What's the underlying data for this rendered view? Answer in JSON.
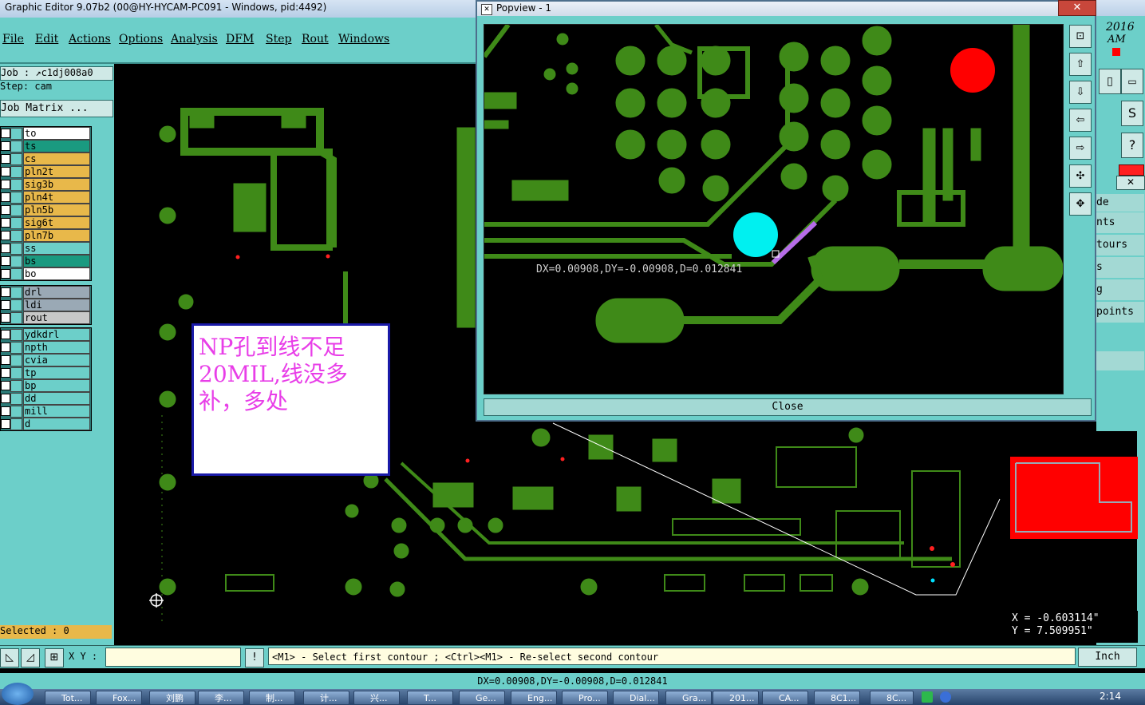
{
  "window": {
    "title": "Graphic Editor 9.07b2 (00@HY-HYCAM-PC091 - Windows, pid:4492)"
  },
  "menu": [
    "File",
    "Edit",
    "Actions",
    "Options",
    "Analysis",
    "DFM",
    "Step",
    "Rout",
    "Windows"
  ],
  "job": {
    "job_label": "Job : ↗c1dj008a0",
    "step_label": "Step: cam",
    "matrix_button": "Job Matrix ..."
  },
  "layers_group1": [
    {
      "name": "to",
      "color": "#ffffff"
    },
    {
      "name": "ts",
      "color": "#1a9a80"
    },
    {
      "name": "cs",
      "color": "#e8b84a"
    },
    {
      "name": "pln2t",
      "color": "#e8b84a"
    },
    {
      "name": "sig3b",
      "color": "#e8b84a"
    },
    {
      "name": "pln4t",
      "color": "#e8b84a"
    },
    {
      "name": "pln5b",
      "color": "#e8b84a"
    },
    {
      "name": "sig6t",
      "color": "#e8b84a"
    },
    {
      "name": "pln7b",
      "color": "#e8b84a"
    },
    {
      "name": "ss",
      "color": "#6ccfc9"
    },
    {
      "name": "bs",
      "color": "#1a9a80"
    },
    {
      "name": "bo",
      "color": "#ffffff"
    }
  ],
  "layers_group2": [
    {
      "name": "drl",
      "color": "#9aa9b5"
    },
    {
      "name": "ldi",
      "color": "#9aa9b5"
    },
    {
      "name": "rout",
      "color": "#c8c8c8"
    }
  ],
  "layers_group3": [
    {
      "name": "ydkdrl",
      "color": "#6ccfc9"
    },
    {
      "name": "npth",
      "color": "#6ccfc9"
    },
    {
      "name": "cvia",
      "color": "#6ccfc9"
    },
    {
      "name": "tp",
      "color": "#6ccfc9"
    },
    {
      "name": "bp",
      "color": "#6ccfc9"
    },
    {
      "name": "dd",
      "color": "#6ccfc9"
    },
    {
      "name": "mill",
      "color": "#6ccfc9"
    },
    {
      "name": "d",
      "color": "#6ccfc9"
    }
  ],
  "selected_label": "Selected : 0",
  "note": {
    "text": "NP孔到线不足20MIL,线没多补，多处"
  },
  "popview": {
    "title": "Popview - 1",
    "measure_text": "DX=0.00908,DY=-0.00908,D=0.012841",
    "close_label": "Close"
  },
  "right_panel": {
    "date": "2016",
    "ampm": "AM",
    "items": [
      "de",
      "nts",
      "tours",
      "s",
      "g",
      "points"
    ]
  },
  "coords": {
    "x": "X = -0.603114\"",
    "y": "Y = 7.509951\""
  },
  "bottom": {
    "xy_label": "X Y :",
    "prompt": "<M1> - Select first contour ; <Ctrl><M1> - Re-select second contour",
    "units": "Inch"
  },
  "status": "DX=0.00908,DY=-0.00908,D=0.012841",
  "taskbar": {
    "items": [
      "Tot...",
      "Fox...",
      "刘鹏",
      "李...",
      "制...",
      "计...",
      "兴...",
      "T...",
      "Ge...",
      "Eng...",
      "Pro...",
      "Dial...",
      "Gra...",
      "201...",
      "CA...",
      "8C1...",
      "8C..."
    ],
    "clock": "2:14"
  },
  "colors": {
    "teal_panel": "#6ccfc9",
    "trace_green": "#3f8a18",
    "highlight_cyan": "#00f0f0",
    "marker_red": "#ff0000",
    "note_text": "#e83ee8"
  }
}
